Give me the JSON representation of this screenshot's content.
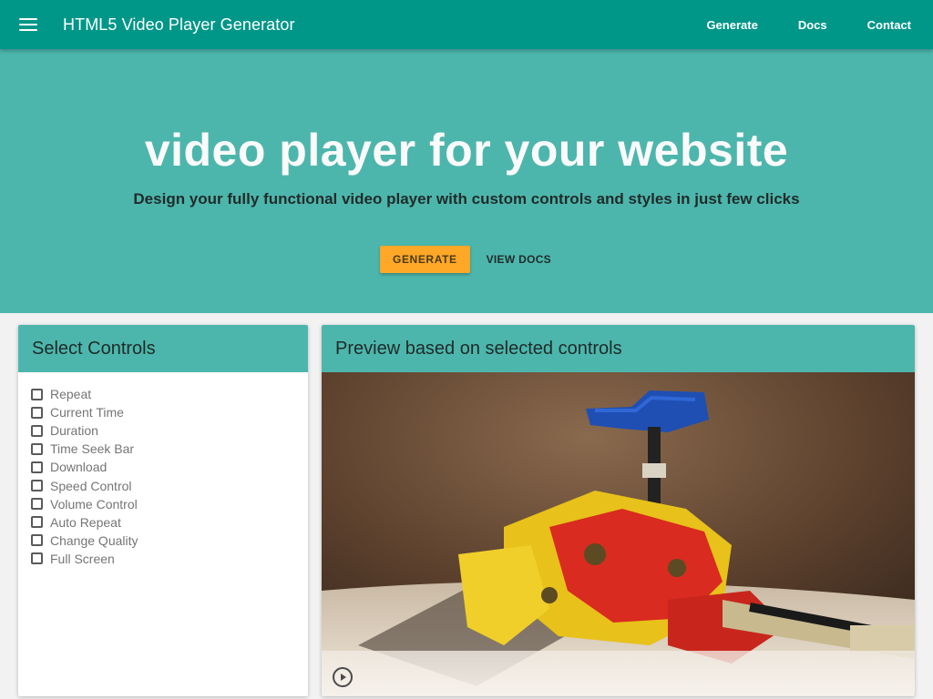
{
  "app": {
    "title": "HTML5 Video Player Generator"
  },
  "nav": {
    "items": [
      "Generate",
      "Docs",
      "Contact"
    ]
  },
  "hero": {
    "title": "video player for your website",
    "subtitle": "Design your fully functional video player with custom controls and styles in just few clicks",
    "primary_button": "GENERATE",
    "secondary_button": "VIEW DOCS"
  },
  "controls_panel": {
    "title": "Select Controls",
    "items": [
      {
        "label": "Repeat",
        "checked": false
      },
      {
        "label": "Current Time",
        "checked": false
      },
      {
        "label": "Duration",
        "checked": false
      },
      {
        "label": "Time Seek Bar",
        "checked": false
      },
      {
        "label": "Download",
        "checked": false
      },
      {
        "label": "Speed Control",
        "checked": false
      },
      {
        "label": "Volume Control",
        "checked": false
      },
      {
        "label": "Auto Repeat",
        "checked": false
      },
      {
        "label": "Change Quality",
        "checked": false
      },
      {
        "label": "Full Screen",
        "checked": false
      }
    ]
  },
  "preview_panel": {
    "title": "Preview based on selected controls"
  },
  "video_controls": {
    "play_icon": "play-circle-icon",
    "menu_icon": "hamburger-menu-icon"
  },
  "colors": {
    "primary": "#009688",
    "hero": "#4db6ac",
    "accent": "#ffa726"
  }
}
